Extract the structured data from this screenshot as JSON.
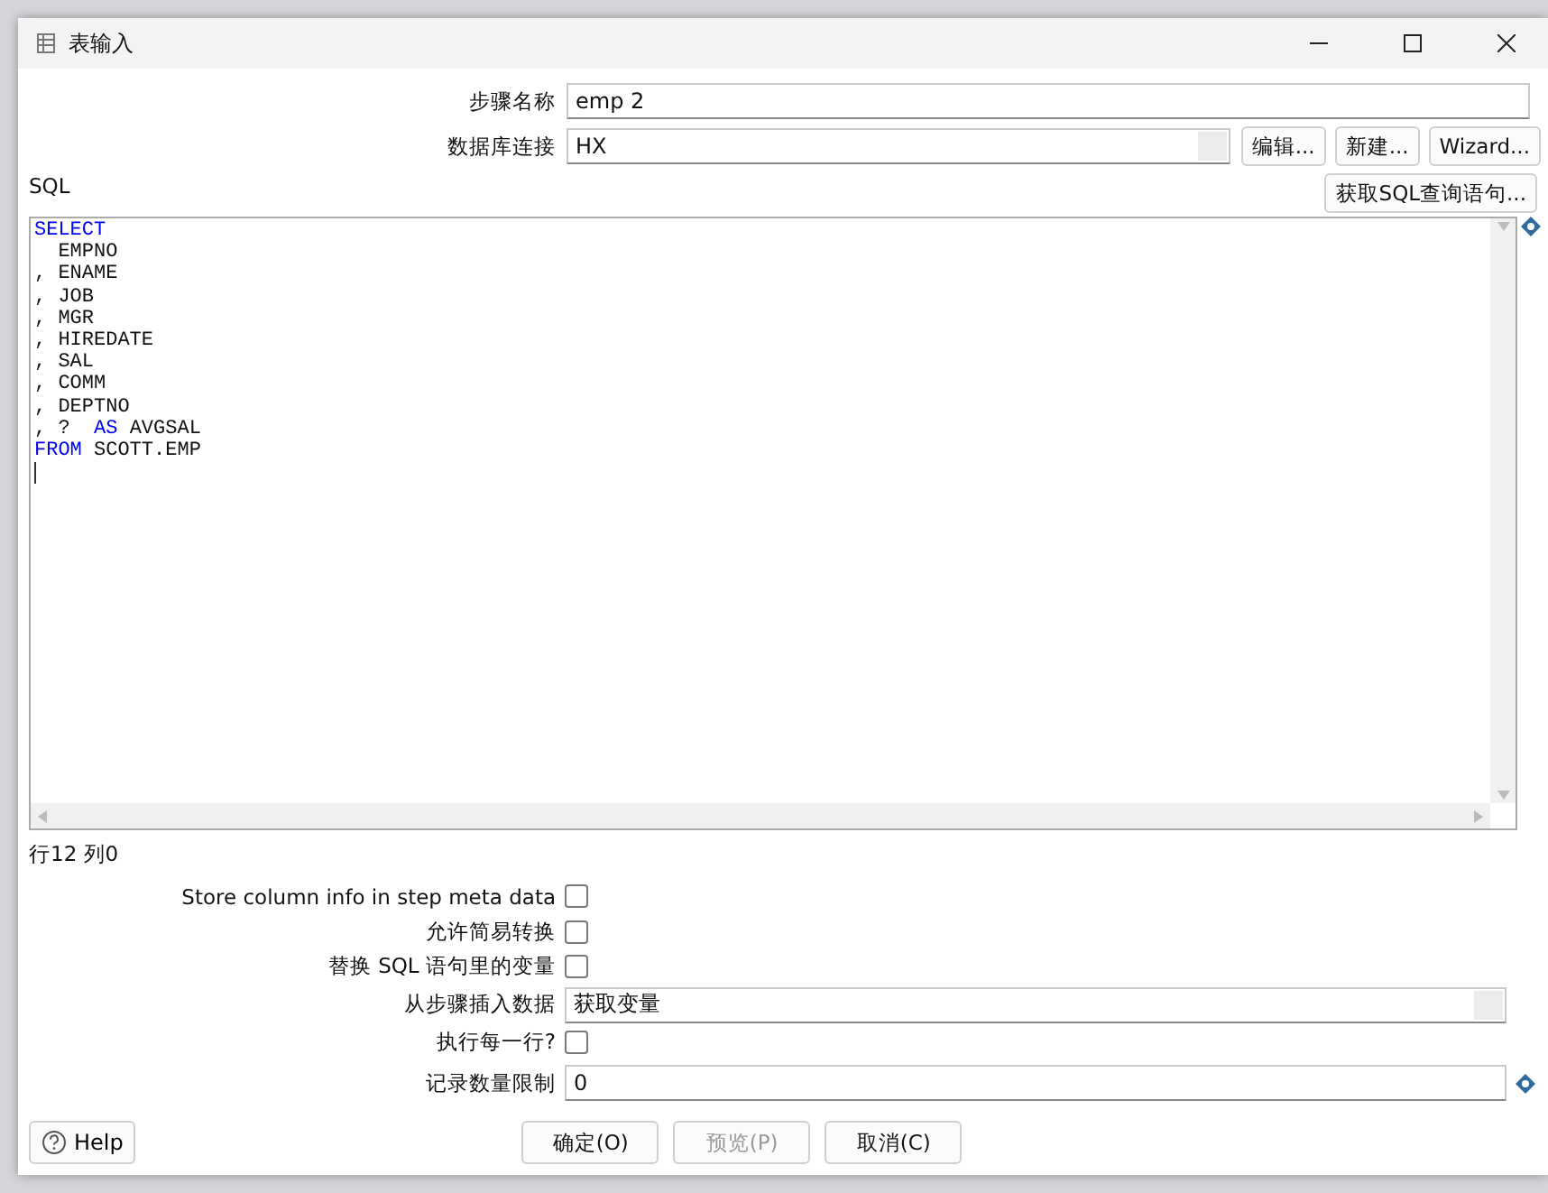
{
  "window": {
    "title": "表输入"
  },
  "step_name": {
    "label": "步骤名称",
    "value": "emp 2"
  },
  "connection": {
    "label": "数据库连接",
    "value": "HX",
    "buttons": [
      "编辑...",
      "新建...",
      "Wizard..."
    ]
  },
  "sql": {
    "label": "SQL",
    "get_button": "获取SQL查询语句...",
    "variable": true,
    "lines": [
      [
        {
          "text": "SELECT",
          "kind": "keyword"
        }
      ],
      [
        {
          "text": "  EMPNO",
          "kind": "plain"
        }
      ],
      [
        {
          "text": ", ENAME",
          "kind": "plain"
        }
      ],
      [
        {
          "text": ", JOB",
          "kind": "plain"
        }
      ],
      [
        {
          "text": ", MGR",
          "kind": "plain"
        }
      ],
      [
        {
          "text": ", HIREDATE",
          "kind": "plain"
        }
      ],
      [
        {
          "text": ", SAL",
          "kind": "plain"
        }
      ],
      [
        {
          "text": ", COMM",
          "kind": "plain"
        }
      ],
      [
        {
          "text": ", DEPTNO",
          "kind": "plain"
        }
      ],
      [
        {
          "text": ", ?  ",
          "kind": "plain"
        },
        {
          "text": "AS",
          "kind": "keyword"
        },
        {
          "text": " AVGSAL",
          "kind": "plain"
        }
      ],
      [
        {
          "text": "FROM",
          "kind": "keyword"
        },
        {
          "text": " SCOTT.EMP",
          "kind": "plain"
        }
      ]
    ]
  },
  "position": "行12 列0",
  "options": [
    {
      "kind": "checkbox",
      "label": "Store column info in step meta data",
      "checked": false
    },
    {
      "kind": "checkbox",
      "label": "允许简易转换",
      "checked": false
    },
    {
      "kind": "checkbox",
      "label": "替换 SQL 语句里的变量",
      "checked": false
    },
    {
      "kind": "combo",
      "label": "从步骤插入数据",
      "value": "获取变量"
    },
    {
      "kind": "checkbox",
      "label": "执行每一行?",
      "checked": false
    },
    {
      "kind": "field",
      "label": "记录数量限制",
      "value": "0",
      "variable": true
    }
  ],
  "help": "Help",
  "buttons": [
    {
      "label": "确定(O)",
      "disabled": false
    },
    {
      "label": "预览(P)",
      "disabled": true
    },
    {
      "label": "取消(C)",
      "disabled": false
    }
  ]
}
